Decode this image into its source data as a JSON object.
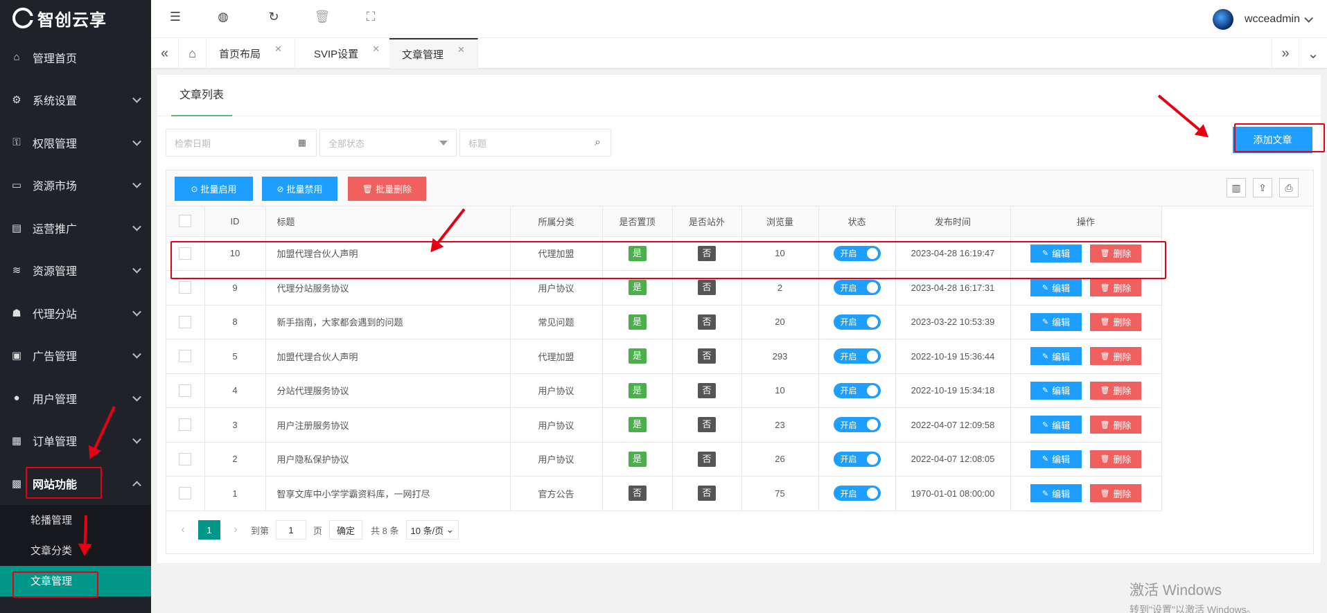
{
  "brand": {
    "name": "智创云享"
  },
  "sidebar": {
    "items": [
      {
        "label": "管理首页",
        "icon": "home-icon"
      },
      {
        "label": "系统设置",
        "icon": "gear-icon"
      },
      {
        "label": "权限管理",
        "icon": "user-lock-icon"
      },
      {
        "label": "资源市场",
        "icon": "store-icon"
      },
      {
        "label": "运营推广",
        "icon": "megaphone-icon"
      },
      {
        "label": "资源管理",
        "icon": "layers-icon"
      },
      {
        "label": "代理分站",
        "icon": "users-icon"
      },
      {
        "label": "广告管理",
        "icon": "ad-icon"
      },
      {
        "label": "用户管理",
        "icon": "user-icon"
      },
      {
        "label": "订单管理",
        "icon": "clipboard-icon"
      },
      {
        "label": "网站功能",
        "icon": "grid-icon"
      }
    ],
    "sub_items": [
      "轮播管理",
      "文章分类",
      "文章管理"
    ]
  },
  "topbar": {
    "username": "wcceadmin"
  },
  "tabs": [
    "首页布局",
    "SVIP设置",
    "文章管理"
  ],
  "card": {
    "tab": "文章列表"
  },
  "filters": {
    "date_placeholder": "检索日期",
    "status_placeholder": "全部状态",
    "title_placeholder": "标题"
  },
  "buttons": {
    "add": "添加文章",
    "batch_enable": "批量启用",
    "batch_disable": "批量禁用",
    "batch_delete": "批量删除",
    "edit": "编辑",
    "delete": "删除"
  },
  "table": {
    "headers": [
      "ID",
      "标题",
      "所属分类",
      "是否置顶",
      "是否站外",
      "浏览量",
      "状态",
      "发布时间",
      "操作"
    ],
    "rows": [
      {
        "id": "10",
        "title": "加盟代理合伙人声明",
        "category": "代理加盟",
        "top": "是",
        "external": "否",
        "views": "10",
        "status": "开启",
        "time": "2023-04-28 16:19:47"
      },
      {
        "id": "9",
        "title": "代理分站服务协议",
        "category": "用户协议",
        "top": "是",
        "external": "否",
        "views": "2",
        "status": "开启",
        "time": "2023-04-28 16:17:31"
      },
      {
        "id": "8",
        "title": "新手指南，大家都会遇到的问题",
        "category": "常见问题",
        "top": "是",
        "external": "否",
        "views": "20",
        "status": "开启",
        "time": "2023-03-22 10:53:39"
      },
      {
        "id": "5",
        "title": "加盟代理合伙人声明",
        "category": "代理加盟",
        "top": "是",
        "external": "否",
        "views": "293",
        "status": "开启",
        "time": "2022-10-19 15:36:44"
      },
      {
        "id": "4",
        "title": "分站代理服务协议",
        "category": "用户协议",
        "top": "是",
        "external": "否",
        "views": "10",
        "status": "开启",
        "time": "2022-10-19 15:34:18"
      },
      {
        "id": "3",
        "title": "用户注册服务协议",
        "category": "用户协议",
        "top": "是",
        "external": "否",
        "views": "23",
        "status": "开启",
        "time": "2022-04-07 12:09:58"
      },
      {
        "id": "2",
        "title": "用户隐私保护协议",
        "category": "用户协议",
        "top": "是",
        "external": "否",
        "views": "26",
        "status": "开启",
        "time": "2022-04-07 12:08:05"
      },
      {
        "id": "1",
        "title": "智享文库中小学学霸资料库，一网打尽",
        "category": "官方公告",
        "top": "否",
        "external": "否",
        "views": "75",
        "status": "开启",
        "time": "1970-01-01 08:00:00"
      }
    ]
  },
  "pagination": {
    "current": "1",
    "goto_label": "到第",
    "page_value": "1",
    "page_unit": "页",
    "confirm": "确定",
    "total": "共 8 条",
    "page_size": "10 条/页"
  },
  "watermark": {
    "line1": "激活 Windows",
    "line2": "转到\"设置\"以激活 Windows。"
  },
  "colors": {
    "sidebar_bg": "#20222a",
    "active_green": "#009688",
    "primary_blue": "#1e9fff",
    "danger_red": "#f0605f",
    "annotation_red": "#e60012"
  }
}
